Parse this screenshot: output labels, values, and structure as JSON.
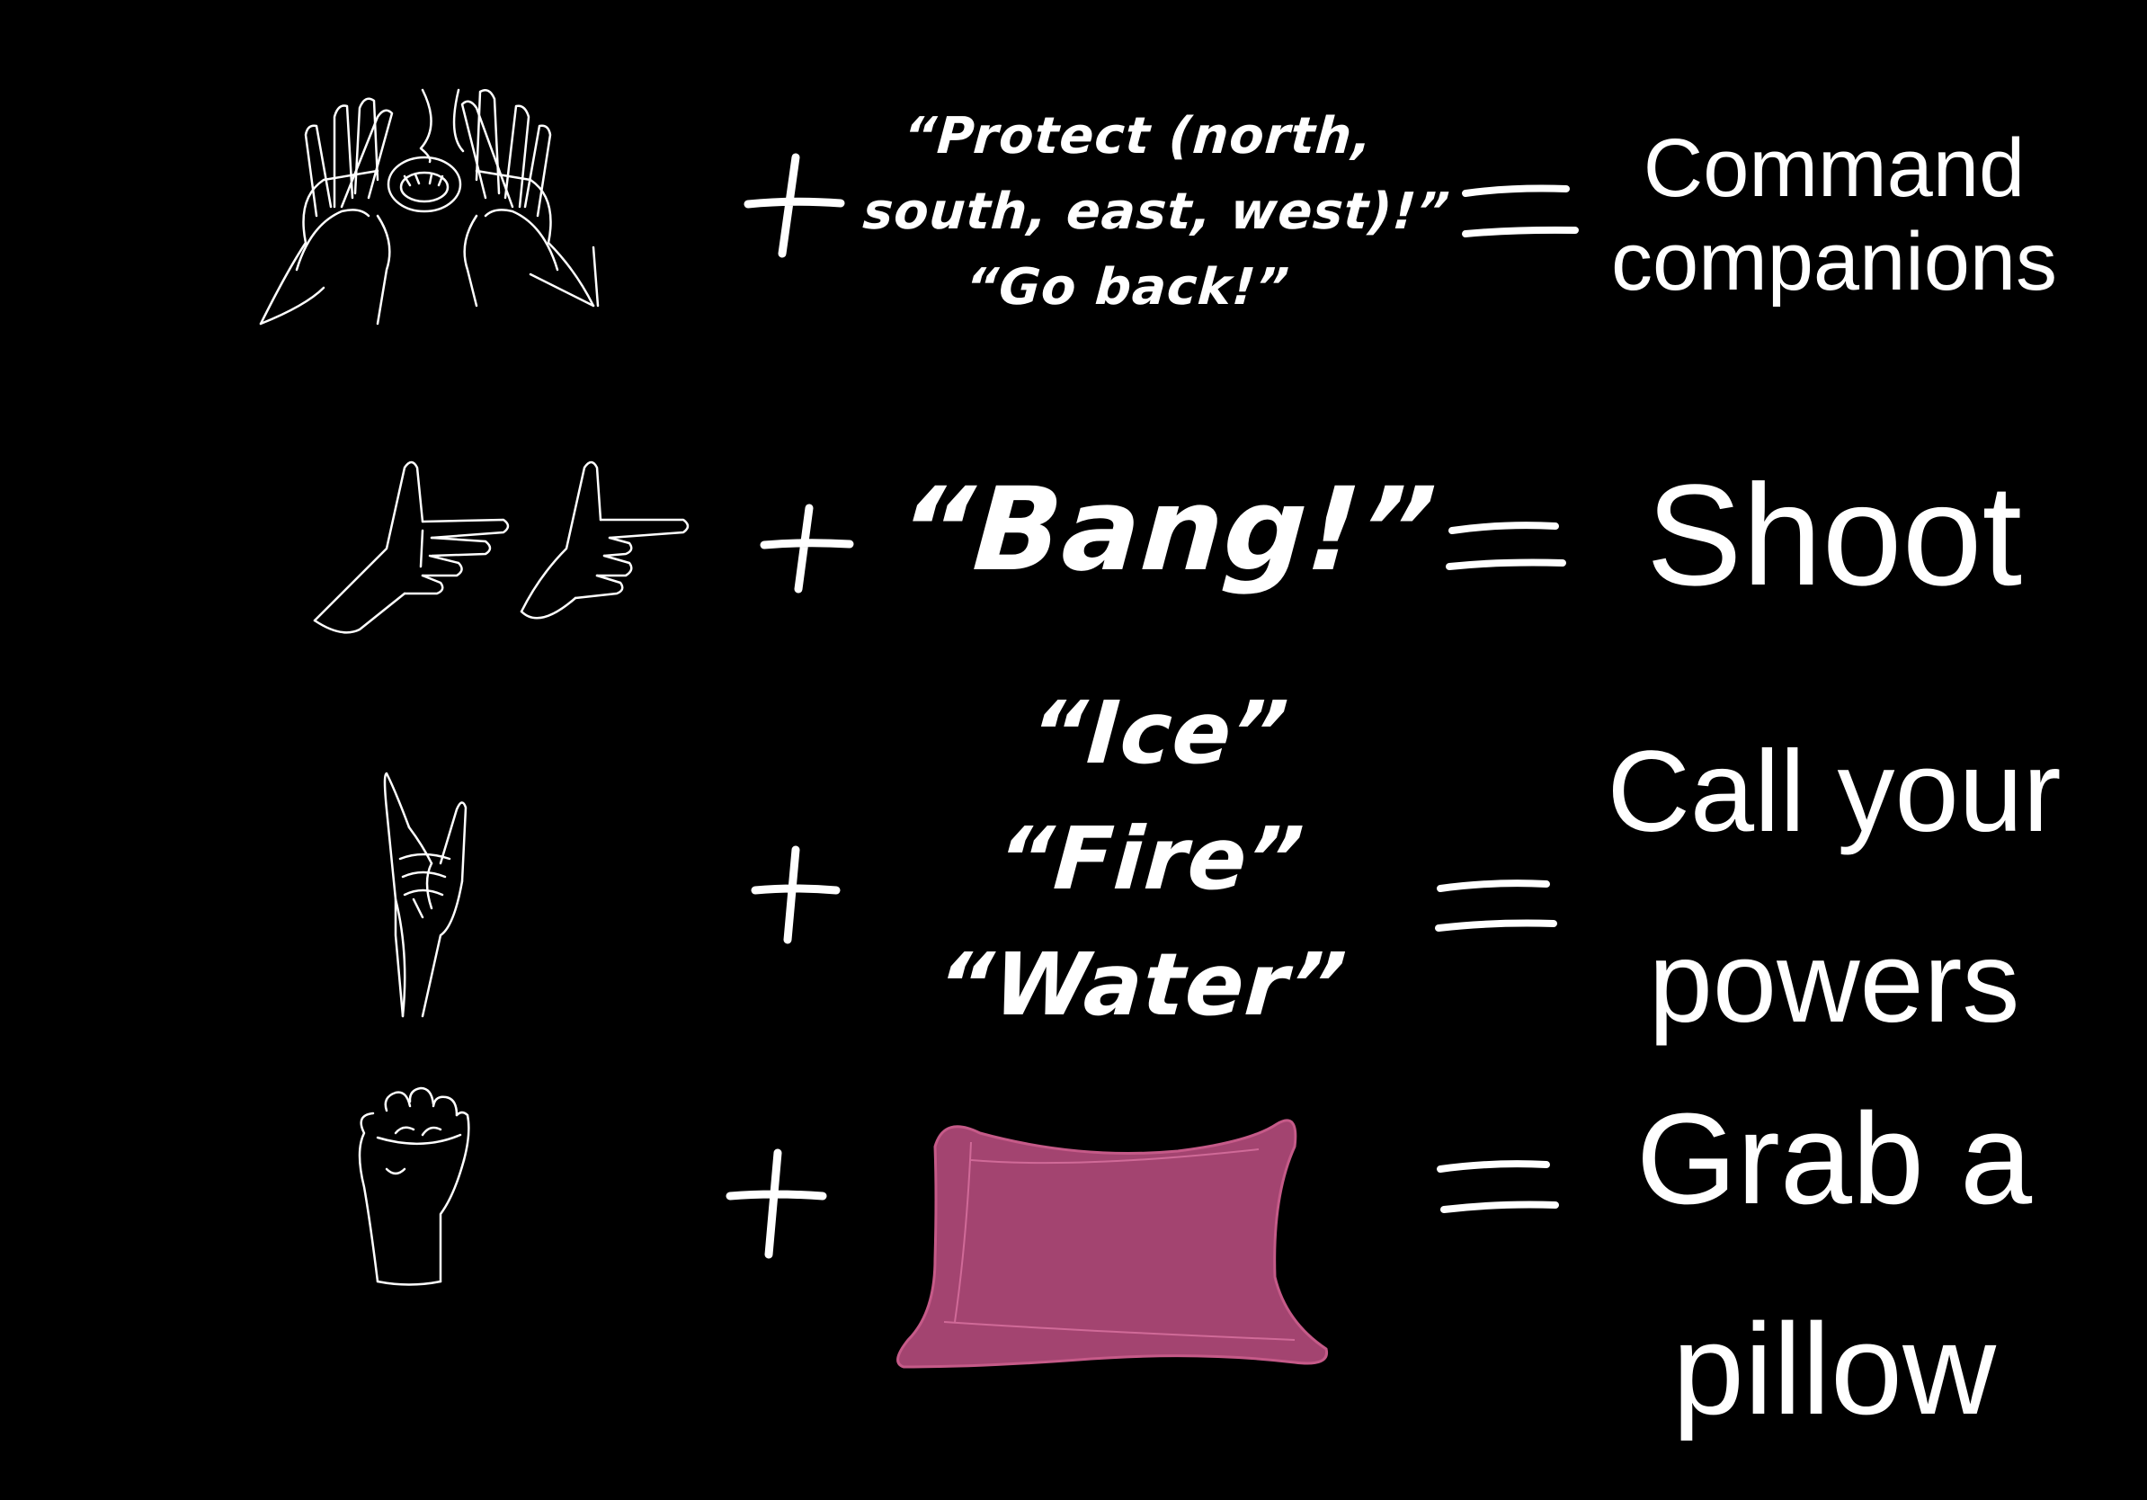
{
  "colors": {
    "background": "#000000",
    "foreground": "#ffffff",
    "pillow": "#a34470",
    "pillow_highlight": "#d06a98"
  },
  "rows": [
    {
      "gesture_icon": "hands-around-mouth-icon",
      "phrase_lines": [
        "“Protect (north,",
        "south, east, west)!”",
        "“Go back!”"
      ],
      "result_lines": [
        "Command",
        "companions"
      ]
    },
    {
      "gesture_icon": "finger-guns-icon",
      "phrase_lines": [
        "“Bang!”"
      ],
      "result_lines": [
        "Shoot"
      ]
    },
    {
      "gesture_icon": "horns-hand-icon",
      "phrase_lines": [
        "“Ice”",
        "“Fire”",
        "“Water”"
      ],
      "result_lines": [
        "Call your",
        "powers"
      ]
    },
    {
      "gesture_icon": "fist-icon",
      "object_icon": "pillow-icon",
      "result_lines": [
        "Grab a",
        "pillow"
      ]
    }
  ]
}
